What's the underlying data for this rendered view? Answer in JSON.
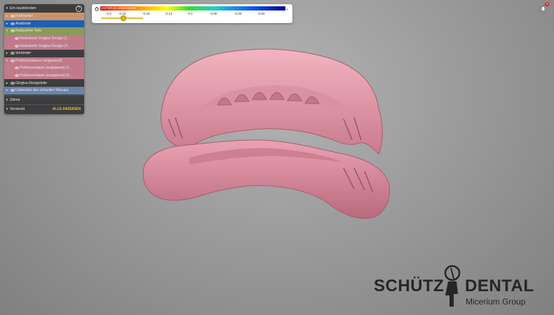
{
  "panel": {
    "title": "Ein-/ausblenden",
    "help_icon": "?",
    "items": [
      {
        "label": "Kieferarten",
        "color": "#c8956a",
        "arrow": "▸"
      },
      {
        "label": "Anatomie",
        "color": "#1f5fb4",
        "arrow": "▸"
      },
      {
        "label": "Reduzierte Teile",
        "color": "#8a9a5b",
        "arrow": "▾"
      },
      {
        "label": "Reduzierte Gingiva Design (1...",
        "color": "#c07a8a",
        "sub": true
      },
      {
        "label": "Reduzierte Gingiva Design (3...",
        "color": "#c07a8a",
        "sub": true
      },
      {
        "label": "Verbinder",
        "color": "#3d3d3f",
        "arrow": "▸"
      },
      {
        "label": "Prothesenbasen (angepasst)",
        "color": "#c07a8a",
        "arrow": "▾"
      },
      {
        "label": "Prothesenbasis (angepasst) (1...",
        "color": "#c07a8a",
        "sub": true
      },
      {
        "label": "Prothesenbasis (angepasst) (3...",
        "color": "#c07a8a",
        "sub": true
      },
      {
        "label": "Gingiva-Designteile",
        "color": "#3d3d3f",
        "arrow": "▸"
      },
      {
        "label": "Unterseite des virtuellen Wasups",
        "color": "#6a84a8",
        "arrow": "▸"
      }
    ],
    "teeth_label": "Zähne",
    "hidden_label": "Versteckt",
    "show_all_label": "ALLE ANZEIGEN"
  },
  "colorbar": {
    "label": "UNTERSCHNEIDUNG",
    "ticks": [
      "-0,2",
      "-0.16",
      "-0.16",
      "-0.13",
      "-0.1",
      "-0.08",
      "-0.05",
      "-0.03"
    ],
    "slider_value": 0.5
  },
  "notifications": {
    "count": "4"
  },
  "logo": {
    "brand_left": "SCHÜTZ",
    "brand_right": "DENTAL",
    "tagline": "Micerium Group"
  },
  "colors": {
    "accent": "#f0c020",
    "denture": "#e69aa8",
    "panel_bg": "#3d3d3f"
  }
}
